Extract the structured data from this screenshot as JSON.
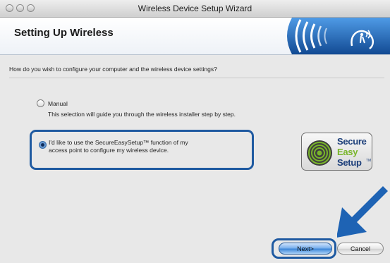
{
  "window": {
    "title": "Wireless Device Setup Wizard"
  },
  "header": {
    "heading": "Setting Up Wireless",
    "logo_icon": "wireless-signal-icon"
  },
  "main": {
    "question": "How do you wish to configure your computer and the wireless device settings?",
    "options": [
      {
        "label": "Manual",
        "description": "This selection will guide you through the wireless installer step by step.",
        "selected": false
      },
      {
        "label_line1": "I'd like to use the SecureEasySetup™ function of my",
        "label_line2": "access point to configure my wireless device.",
        "selected": true
      }
    ],
    "badge": {
      "word1": "Secure",
      "word2": "Easy",
      "word3": "Setup",
      "superscript": "TM"
    }
  },
  "buttons": {
    "next": "Next>",
    "cancel": "Cancel"
  },
  "colors": {
    "accent_blue": "#1f5aa1",
    "arrow_blue": "#1e63b4",
    "badge_green": "#79b52a",
    "badge_navy": "#1d3f7a"
  }
}
